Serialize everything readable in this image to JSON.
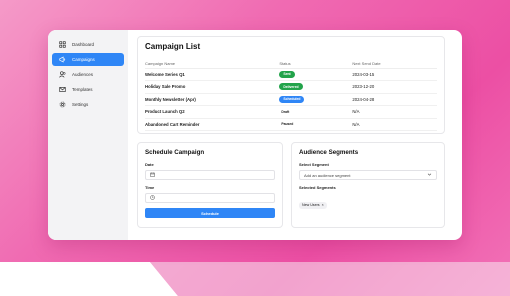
{
  "sidebar": {
    "items": [
      {
        "label": "Dashboard",
        "icon": "grid-icon",
        "active": false
      },
      {
        "label": "Campaigns",
        "icon": "megaphone-icon",
        "active": true
      },
      {
        "label": "Audiences",
        "icon": "users-icon",
        "active": false
      },
      {
        "label": "Templates",
        "icon": "mail-icon",
        "active": false
      },
      {
        "label": "Settings",
        "icon": "gear-icon",
        "active": false
      }
    ]
  },
  "campaign_list": {
    "title": "Campaign List",
    "columns": [
      "Campaign Name",
      "Status",
      "Next Send Date"
    ],
    "rows": [
      {
        "name": "Welcome Series Q1",
        "status": "Sent",
        "status_color": "#22a34a",
        "date": "2024-03-15"
      },
      {
        "name": "Holiday Sale Promo",
        "status": "Delivered",
        "status_color": "#22a34a",
        "date": "2023-12-20"
      },
      {
        "name": "Monthly Newsletter (Apr)",
        "status": "Scheduled",
        "status_color": "#2f86f6",
        "date": "2024-04-28"
      },
      {
        "name": "Product Launch Q2",
        "status": "Draft",
        "status_color": "",
        "date": "N/A"
      },
      {
        "name": "Abandoned Cart Reminder",
        "status": "Paused",
        "status_color": "",
        "date": "N/A"
      }
    ]
  },
  "schedule": {
    "title": "Schedule Campaign",
    "date_label": "Date",
    "time_label": "Time",
    "button_label": "Schedule"
  },
  "audience": {
    "title": "Audience Segments",
    "select_label": "Select Segment",
    "select_placeholder": "Add an audience segment",
    "selected_label": "Selected Segments",
    "chips": [
      "New Users"
    ]
  },
  "colors": {
    "accent": "#2f86f6",
    "success": "#22a34a"
  }
}
